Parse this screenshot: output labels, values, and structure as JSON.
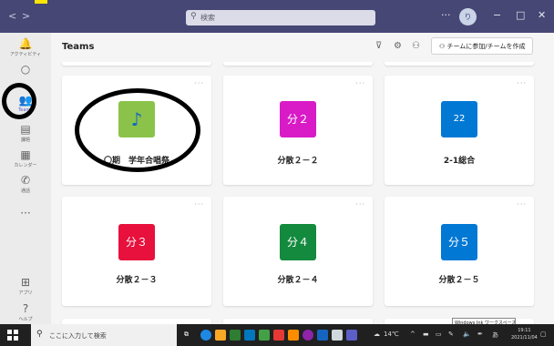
{
  "titlebar": {
    "search_placeholder": "検索",
    "back_icon": "chevron-left-icon",
    "forward_icon": "chevron-right-icon",
    "more_label": "···",
    "avatar_initial": "り",
    "minimize_label": "−",
    "maximize_label": "□",
    "close_label": "✕",
    "color": "#464775"
  },
  "rail": {
    "items": [
      {
        "label": "アクティビティ",
        "icon": "bell-icon",
        "glyph": "🔔"
      },
      {
        "label": "",
        "icon": "chat-icon",
        "glyph": "○"
      },
      {
        "label": "Teams",
        "icon": "teams-icon",
        "glyph": "👥"
      },
      {
        "label": "課題",
        "icon": "assignment-icon",
        "glyph": "▤"
      },
      {
        "label": "カレンダー",
        "icon": "calendar-icon",
        "glyph": "▦"
      },
      {
        "label": "通話",
        "icon": "phone-icon",
        "glyph": "✆"
      },
      {
        "label": "",
        "icon": "more-icon",
        "glyph": "···"
      },
      {
        "label": "アプリ",
        "icon": "apps-icon",
        "glyph": "⊞"
      },
      {
        "label": "ヘルプ",
        "icon": "help-icon",
        "glyph": "?"
      }
    ]
  },
  "header": {
    "title": "Teams",
    "join_label": "チームに参加/チームを作成",
    "filter_icon": "filter-icon",
    "settings_icon": "gear-icon",
    "manage_icon": "people-icon"
  },
  "cards": [
    {
      "name": "〇期　学年合唱祭",
      "tile_text": "♪",
      "tile_color": "#8bc34a",
      "tile_text_color": "#1565c0"
    },
    {
      "name": "分散２－２",
      "tile_text": "分２",
      "tile_color": "#d81bc7",
      "tile_text_color": "#ffffff"
    },
    {
      "name": "2-1総合",
      "tile_text": "22",
      "tile_color": "#0078d4",
      "tile_text_color": "#ffffff"
    },
    {
      "name": "分散２－３",
      "tile_text": "分３",
      "tile_color": "#e8103c",
      "tile_text_color": "#ffffff"
    },
    {
      "name": "分散２－４",
      "tile_text": "分４",
      "tile_color": "#138a3e",
      "tile_text_color": "#ffffff"
    },
    {
      "name": "分散２－５",
      "tile_text": "分５",
      "tile_color": "#0078d4",
      "tile_text_color": "#ffffff"
    }
  ],
  "card_more_label": "···",
  "tooltip": "Windows Ink ワークスペース",
  "taskbar": {
    "search_placeholder": "ここに入力して検索",
    "weather": "14℃",
    "time": "19:11",
    "date": "2021/11/04"
  }
}
